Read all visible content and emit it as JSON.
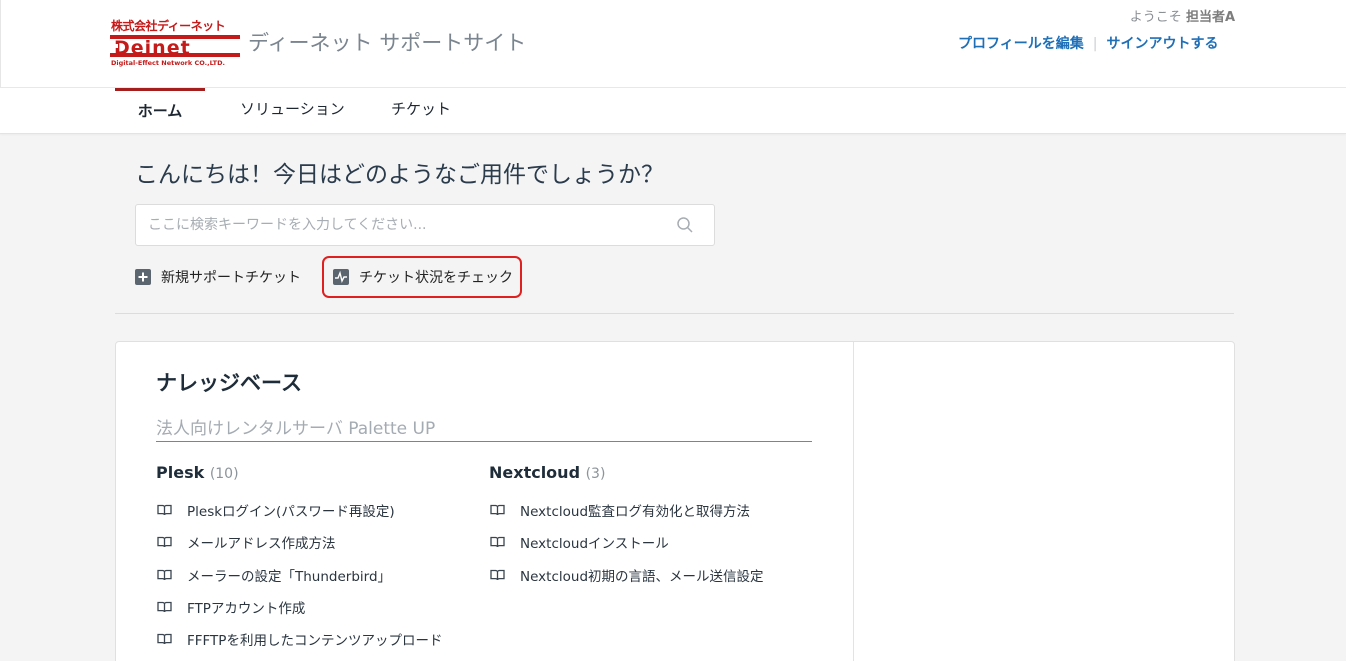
{
  "header": {
    "logo_top": "株式会社ディーネット",
    "logo_sub": "Digital-Effect Network CO.,LTD.",
    "site_title": "ディーネット サポートサイト",
    "welcome_prefix": "ようこそ",
    "user_name": "担当者A",
    "edit_profile": "プロフィールを編集",
    "sign_out": "サインアウトする"
  },
  "nav": {
    "items": [
      {
        "label": "ホーム"
      },
      {
        "label": "ソリューション"
      },
      {
        "label": "チケット"
      }
    ]
  },
  "hero": {
    "greeting": "こんにちは！今日はどのようなご用件でしょうか？",
    "search_placeholder": "ここに検索キーワードを入力してください...",
    "new_ticket": "新規サポートチケット",
    "check_status": "チケット状況をチェック"
  },
  "kb": {
    "title": "ナレッジベース",
    "category": "法人向けレンタルサーバ Palette UP",
    "sections": [
      {
        "name": "Plesk",
        "count": "(10)",
        "articles": [
          "Pleskログイン(パスワード再設定)",
          "メールアドレス作成方法",
          "メーラーの設定「Thunderbird」",
          "FTPアカウント作成",
          "FFFTPを利用したコンテンツアップロード"
        ]
      },
      {
        "name": "Nextcloud",
        "count": "(3)",
        "articles": [
          "Nextcloud監査ログ有効化と取得方法",
          "Nextcloudインストール",
          "Nextcloud初期の言語、メール送信設定"
        ]
      }
    ]
  },
  "colors": {
    "brand_red": "#c51a1a",
    "link_blue": "#1f6fb7",
    "nav_active": "#a51e1e",
    "highlight": "#e02020",
    "category_underline": "#3aa590"
  }
}
